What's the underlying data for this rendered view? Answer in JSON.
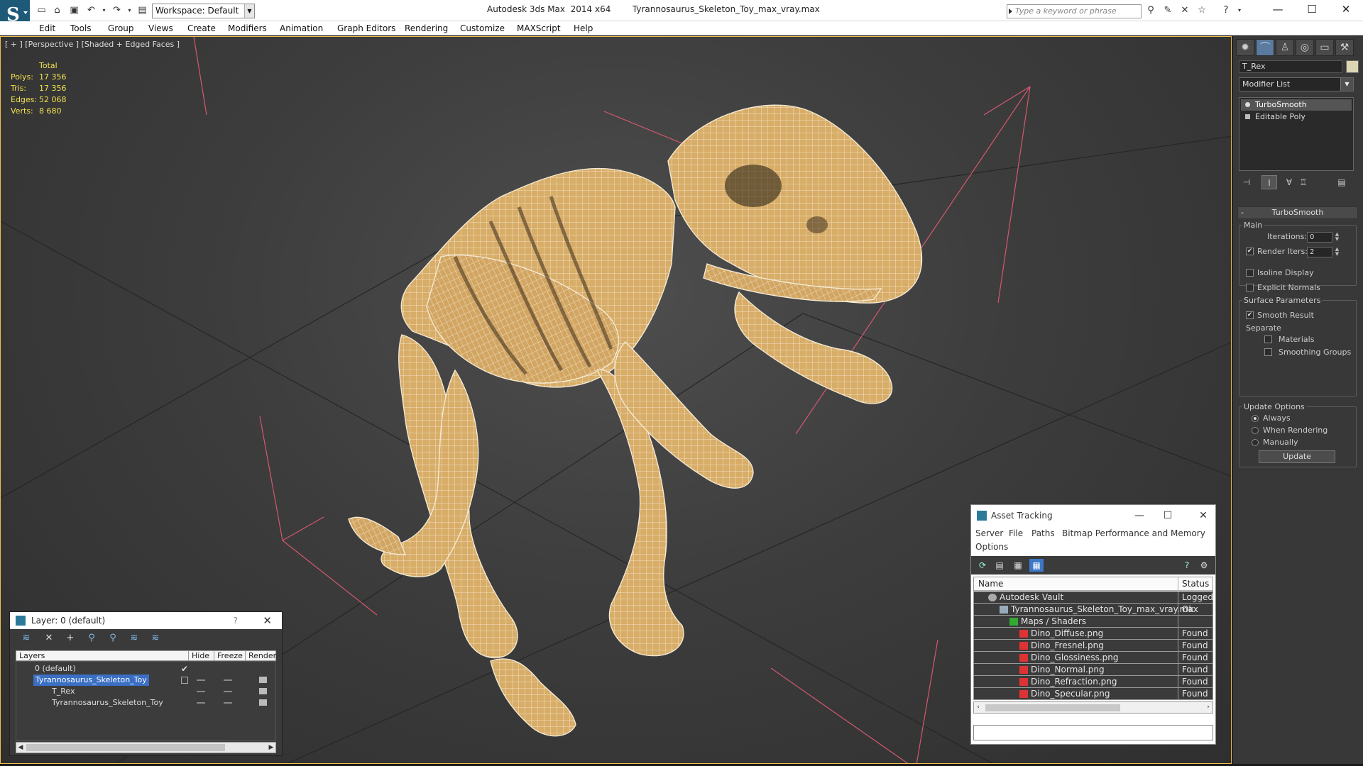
{
  "titlebar": {
    "workspace": "Workspace: Default",
    "app_name": "Autodesk 3ds Max  2014 x64",
    "file_name": "Tyrannosaurus_Skeleton_Toy_max_vray.max",
    "search_placeholder": "Type a keyword or phrase"
  },
  "menu": [
    "Edit",
    "Tools",
    "Group",
    "Views",
    "Create",
    "Modifiers",
    "Animation",
    "Graph Editors",
    "Rendering",
    "Customize",
    "MAXScript",
    "Help"
  ],
  "viewport": {
    "label": "[ + ] [Perspective ] [Shaded + Edged Faces ]",
    "stats_header": "Total",
    "stats": [
      {
        "key": "Polys:",
        "value": "17 356"
      },
      {
        "key": "Tris:",
        "value": "17 356"
      },
      {
        "key": "Edges:",
        "value": "52 068"
      },
      {
        "key": "Verts:",
        "value": "8 680"
      }
    ],
    "accent_color": "#f0c14a",
    "model_color": "#d8ad68"
  },
  "command_panel": {
    "object_name": "T_Rex",
    "modifier_list": "Modifier List",
    "stack": [
      "TurboSmooth",
      "Editable Poly"
    ],
    "rollout_title": "TurboSmooth",
    "main_group": "Main",
    "iterations_label": "Iterations:",
    "iterations_value": "0",
    "render_iters_label": "Render Iters:",
    "render_iters_value": "2",
    "isoline_label": "Isoline Display",
    "explicit_normals_label": "Explicit Normals",
    "surface_group": "Surface Parameters",
    "smooth_result_label": "Smooth Result",
    "separate_label": "Separate",
    "materials_label": "Materials",
    "smoothing_groups_label": "Smoothing Groups",
    "update_group": "Update Options",
    "always_label": "Always",
    "when_rendering_label": "When Rendering",
    "manually_label": "Manually",
    "update_button": "Update"
  },
  "layer_panel": {
    "title": "Layer: 0 (default)",
    "help": "?",
    "columns": [
      "Layers",
      "Hide",
      "Freeze",
      "Render"
    ],
    "rows": [
      {
        "name": "0 (default)"
      },
      {
        "name": "Tyrannosaurus_Skeleton_Toy"
      },
      {
        "name": "T_Rex"
      },
      {
        "name": "Tyrannosaurus_Skeleton_Toy"
      }
    ]
  },
  "asset_panel": {
    "title": "Asset Tracking",
    "menu": [
      "Server",
      "File",
      "Paths",
      "Bitmap Performance and Memory",
      "Options"
    ],
    "columns": [
      "Name",
      "Status"
    ],
    "rows": [
      {
        "name": "Autodesk Vault",
        "status": "Logged"
      },
      {
        "name": "Tyrannosaurus_Skeleton_Toy_max_vray.max",
        "status": "Ok"
      },
      {
        "name": "Maps / Shaders",
        "status": ""
      },
      {
        "name": "Dino_Diffuse.png",
        "status": "Found"
      },
      {
        "name": "Dino_Fresnel.png",
        "status": "Found"
      },
      {
        "name": "Dino_Glossiness.png",
        "status": "Found"
      },
      {
        "name": "Dino_Normal.png",
        "status": "Found"
      },
      {
        "name": "Dino_Refraction.png",
        "status": "Found"
      },
      {
        "name": "Dino_Specular.png",
        "status": "Found"
      }
    ]
  }
}
